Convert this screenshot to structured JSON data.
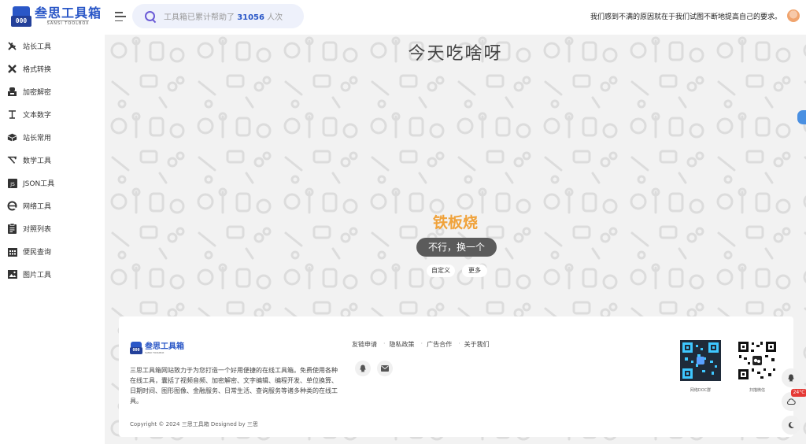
{
  "header": {
    "logo_cn": "叁思工具箱",
    "logo_en": "SANSI TOOLBOX",
    "logo_box": "000",
    "search": {
      "prefix": "工具箱已累计帮助了",
      "count": "31056",
      "suffix": "人次"
    },
    "notice": "我们感到不满的原因就在于我们试图不断地提高自己的要求。"
  },
  "sidebar": {
    "items": [
      {
        "label": "站长工具",
        "icon": "tools-icon"
      },
      {
        "label": "格式转换",
        "icon": "convert-icon"
      },
      {
        "label": "加密解密",
        "icon": "lock-icon"
      },
      {
        "label": "文本数字",
        "icon": "text-icon"
      },
      {
        "label": "站长常用",
        "icon": "box-icon"
      },
      {
        "label": "数学工具",
        "icon": "math-icon"
      },
      {
        "label": "JSON工具",
        "icon": "json-icon"
      },
      {
        "label": "网络工具",
        "icon": "network-icon"
      },
      {
        "label": "对照列表",
        "icon": "list-icon"
      },
      {
        "label": "便民查询",
        "icon": "calendar-icon"
      },
      {
        "label": "图片工具",
        "icon": "image-icon"
      }
    ]
  },
  "main": {
    "headline": "今天吃啥呀",
    "food": "铁板烧",
    "change_button": "不行，换一个",
    "custom_chip": "自定义",
    "more_chip": "更多"
  },
  "footer": {
    "logo_cn": "叁思工具箱",
    "logo_en": "SANSI TOOLBOX",
    "description": "三思工具箱网站致力于为您打造一个好用便捷的在线工具箱。免费使用各种在线工具，囊括了视频音频、加密解密、文字编辑、编程开发、单位换算、日期时间、图形图像、金融服务、日常生活、查询服务等诸多种类的在线工具。",
    "copyright": "Copyright © 2024 三思工具箱   Designed by 三思",
    "links": [
      "友链申请",
      "隐私政策",
      "广告合作",
      "关于我们"
    ],
    "qr1_label": "网络DOC群",
    "qr2_label": "扫描微信"
  },
  "float": {
    "temp": "24°C"
  },
  "colors": {
    "brand": "#2a57c7",
    "food": "#f0a23a",
    "button": "#5b5b5b"
  }
}
